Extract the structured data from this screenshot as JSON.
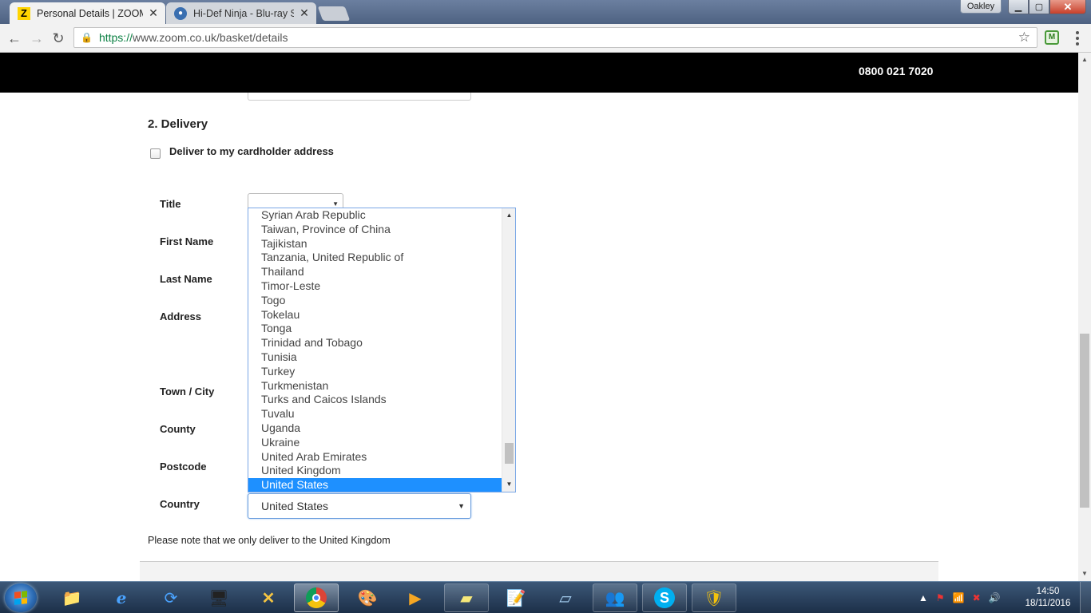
{
  "browser": {
    "tabs": [
      {
        "title": "Personal Details | ZOOM",
        "favicon": "Z",
        "active": true
      },
      {
        "title": "Hi-Def Ninja - Blu-ray St",
        "favicon": "ninja-icon",
        "active": false
      }
    ],
    "profile_name": "Oakley",
    "url_scheme": "https://",
    "url_rest": "www.zoom.co.uk/basket/details",
    "extension_label": "M"
  },
  "site": {
    "phone": "0800 021 7020"
  },
  "delivery": {
    "section_title": "2. Delivery",
    "cardholder_checkbox_label": "Deliver to my cardholder address",
    "cardholder_checked": false,
    "labels": {
      "title": "Title",
      "first_name": "First Name",
      "last_name": "Last Name",
      "address": "Address",
      "town": "Town / City",
      "county": "County",
      "postcode": "Postcode",
      "country": "Country"
    },
    "title_value": "",
    "country_value": "United States",
    "country_options": [
      "Syrian Arab Republic",
      "Taiwan, Province of China",
      "Tajikistan",
      "Tanzania, United Republic of",
      "Thailand",
      "Timor-Leste",
      "Togo",
      "Tokelau",
      "Tonga",
      "Trinidad and Tobago",
      "Tunisia",
      "Turkey",
      "Turkmenistan",
      "Turks and Caicos Islands",
      "Tuvalu",
      "Uganda",
      "Ukraine",
      "United Arab Emirates",
      "United Kingdom",
      "United States"
    ],
    "selected_option": "United States",
    "note": "Please note that we only deliver to the United Kingdom"
  },
  "taskbar": {
    "time": "14:50",
    "date": "18/11/2016",
    "pinned": [
      "explorer-icon",
      "ie-icon",
      "sync-icon",
      "control-panel-icon",
      "xsplit-icon",
      "chrome-icon",
      "paint-icon",
      "media-player-icon",
      "sticky-notes-icon",
      "notepad-icon",
      "notes-icon",
      "network-icon",
      "skype-icon",
      "security-shield-icon"
    ]
  },
  "colors": {
    "header_bg": "#000000",
    "selected_option_bg": "#1e90ff",
    "secure_green": "#0b8043"
  }
}
